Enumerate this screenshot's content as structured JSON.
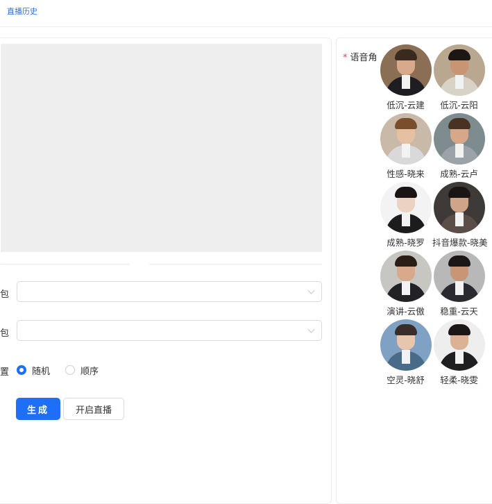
{
  "topbar": {
    "history_link": "直播历史"
  },
  "form": {
    "row1_label": "包:",
    "row2_label": "包:",
    "row3_label": "置:",
    "radio_random": "随机",
    "radio_order": "顺序",
    "selected_radio": "随机"
  },
  "actions": {
    "generate": "生成",
    "start_live": "开启直播"
  },
  "voice": {
    "label": "语音角",
    "required_mark": "*",
    "items": [
      {
        "name": "低沉-云建",
        "skin": "#d8a98a",
        "hair": "#3a2a1e",
        "bg": "#8a6f55",
        "suit": "#1d1d22"
      },
      {
        "name": "低沉-云阳",
        "skin": "#c99471",
        "hair": "#1c1614",
        "bg": "#b9a790",
        "suit": "#d9d2c6"
      },
      {
        "name": "性感-晓来",
        "skin": "#e6c0a3",
        "hair": "#7a4e2c",
        "bg": "#c8b9a8",
        "suit": "#d9d9d9"
      },
      {
        "name": "成熟-云卢",
        "skin": "#d6a889",
        "hair": "#4a3223",
        "bg": "#7f8c8f",
        "suit": "#9ca3a8"
      },
      {
        "name": "成熟-晓罗",
        "skin": "#ecd2c1",
        "hair": "#1a1414",
        "bg": "#f3f3f3",
        "suit": "#1c1c1f"
      },
      {
        "name": "抖音爆款-晓美",
        "skin": "#cfa58a",
        "hair": "#1a1515",
        "bg": "#3e3a38",
        "suit": "#5a4e46"
      },
      {
        "name": "演讲-云傲",
        "skin": "#d9a98b",
        "hair": "#2a1e17",
        "bg": "#c8c6c2",
        "suit": "#222226"
      },
      {
        "name": "稳重-云天",
        "skin": "#c89576",
        "hair": "#1b1716",
        "bg": "#b8b8b8",
        "suit": "#2a2a30"
      },
      {
        "name": "空灵-晓舒",
        "skin": "#e8c6ad",
        "hair": "#3a2c28",
        "bg": "#7ea1c4",
        "suit": "#4a6a8a"
      },
      {
        "name": "轻柔-晓雯",
        "skin": "#dcb294",
        "hair": "#1c1616",
        "bg": "#eeeeee",
        "suit": "#1f1f22"
      }
    ]
  }
}
